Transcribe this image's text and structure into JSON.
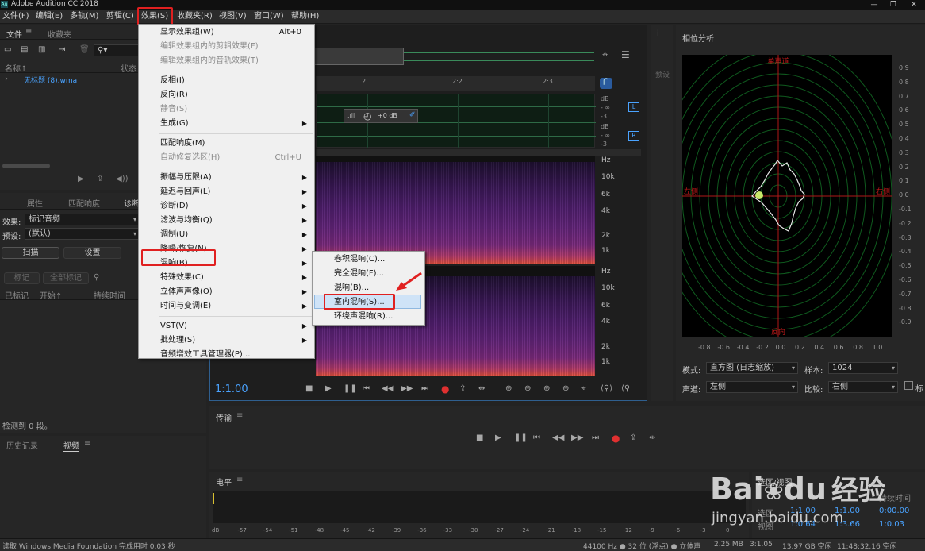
{
  "window": {
    "title": "Adobe Audition CC 2018",
    "logo": "Au"
  },
  "menubar": {
    "items": [
      "文件(F)",
      "编辑(E)",
      "多轨(M)",
      "剪辑(C)",
      "效果(S)",
      "收藏夹(R)",
      "视图(V)",
      "窗口(W)",
      "帮助(H)"
    ]
  },
  "left_top": {
    "tab_files": "文件",
    "tab_fav": "收藏夹",
    "col_name": "名称↑",
    "col_status": "状态",
    "file_name": "无标题 (8).wma"
  },
  "left_mid": {
    "tab_props": "属性",
    "tab_match": "匹配响度",
    "tab_diag": "诊断",
    "effect_label": "效果:",
    "effect_value": "标记音频",
    "preset_label": "预设:",
    "preset_value": "(默认)",
    "scan_btn": "扫描",
    "settings_btn": "设置",
    "mark_btn": "标记",
    "mark_all_btn": "全部标记",
    "col_marked": "已标记",
    "col_start": "开始↑",
    "col_dur": "持续时间",
    "status": "检测到 0 段。"
  },
  "left_bottom": {
    "tab_history": "历史记录",
    "tab_video": "视频"
  },
  "effects_menu": {
    "items": [
      {
        "label": "显示效果组(W)",
        "shortcut": "Alt+0",
        "disabled": false
      },
      {
        "label": "编辑效果组内的剪辑效果(F)",
        "disabled": true
      },
      {
        "label": "编辑效果组内的音轨效果(T)",
        "disabled": true
      },
      {
        "label": "反相(I)",
        "disabled": false
      },
      {
        "label": "反向(R)",
        "disabled": false
      },
      {
        "label": "静音(S)",
        "disabled": true
      },
      {
        "label": "生成(G)",
        "submenu": true
      },
      {
        "label": "匹配响度(M)",
        "disabled": false
      },
      {
        "label": "自动修复选区(H)",
        "shortcut": "Ctrl+U",
        "disabled": true
      },
      {
        "label": "振幅与压限(A)",
        "submenu": true
      },
      {
        "label": "延迟与回声(L)",
        "submenu": true
      },
      {
        "label": "诊断(D)",
        "submenu": true
      },
      {
        "label": "滤波与均衡(Q)",
        "submenu": true
      },
      {
        "label": "调制(U)",
        "submenu": true
      },
      {
        "label": "降噪/恢复(N)",
        "submenu": true
      },
      {
        "label": "混响(B)",
        "submenu": true,
        "highlighted": true
      },
      {
        "label": "特殊效果(C)",
        "submenu": true
      },
      {
        "label": "立体声声像(O)",
        "submenu": true
      },
      {
        "label": "时间与变调(E)",
        "submenu": true
      },
      {
        "label": "VST(V)",
        "submenu": true
      },
      {
        "label": "批处理(S)",
        "submenu": true
      },
      {
        "label": "音频增效工具管理器(P)...",
        "disabled": false
      }
    ]
  },
  "reverb_submenu": {
    "items": [
      "卷积混响(C)...",
      "完全混响(F)...",
      "混响(B)...",
      "室内混响(S)...",
      "环绕声混响(R)..."
    ]
  },
  "editor": {
    "ruler": [
      "2:1",
      "2:2",
      "2:3"
    ],
    "clip_gain": "+0 dB",
    "db_labels": [
      "dB",
      "- ∞",
      "-3",
      "dB",
      "- ∞",
      "-3"
    ],
    "ch_L": "L",
    "ch_R": "R",
    "hz_top": [
      "Hz",
      "10k",
      "6k",
      "4k",
      "2k",
      "1k"
    ],
    "hz_bottom": [
      "Hz",
      "10k",
      "6k",
      "4k",
      "2k",
      "1k"
    ],
    "time": "1:1.00"
  },
  "transport": {
    "title": "传输"
  },
  "levels": {
    "title": "电平",
    "scale": [
      "dB",
      "-57",
      "-54",
      "-51",
      "-48",
      "-45",
      "-42",
      "-39",
      "-36",
      "-33",
      "-30",
      "-27",
      "-24",
      "-21",
      "-18",
      "-15",
      "-12",
      "-9",
      "-6",
      "-3",
      "0"
    ]
  },
  "phase": {
    "title": "相位分析",
    "top": "单声道",
    "left": "左侧",
    "right": "右侧",
    "bottom": "反向",
    "y_ticks": [
      "0.9",
      "0.8",
      "0.7",
      "0.6",
      "0.5",
      "0.4",
      "0.3",
      "0.2",
      "0.1",
      "0.0",
      "-0.1",
      "-0.2",
      "-0.3",
      "-0.4",
      "-0.5",
      "-0.6",
      "-0.7",
      "-0.8",
      "-0.9"
    ],
    "x_ticks": [
      "-0.8",
      "-0.6",
      "-0.4",
      "-0.2",
      "0.0",
      "0.2",
      "0.4",
      "0.6",
      "0.8",
      "1.0"
    ],
    "mode_label": "模式:",
    "mode_value": "直方图 (日志缩放)",
    "sample_label": "样本:",
    "sample_value": "1024",
    "channel_label": "声道:",
    "channel_value": "左侧",
    "compare_label": "比较:",
    "compare_value": "右侧",
    "extra": "标"
  },
  "selection": {
    "title": "选区/视图",
    "col_dur": "持续时间",
    "row_sel": "选区",
    "row_view": "视图",
    "sel_start": "1:1.00",
    "sel_end": "1:1.00",
    "sel_dur": "0:00.00",
    "view_start": "1:0.64",
    "view_end": "1:3.66",
    "view_dur": "1:0.03"
  },
  "statusbar": {
    "left": "读取 Windows Media Foundation 完成用时 0.03 秒",
    "rate": "44100 Hz ● 32 位 (浮点) ● 立体声",
    "size": "2.25 MB",
    "dur": "3:1.05",
    "free": "13.97 GB 空闲",
    "time": "11:48:32.16 空闲"
  },
  "watermark": {
    "text": "经验",
    "domain": "jingyan.baidu.com",
    "brand": "Bai",
    "brand2": "du"
  },
  "colors": {
    "menu_bg": "#f0f0f0",
    "highlight_box": "#e02020",
    "accent": "#4aa3ff"
  }
}
